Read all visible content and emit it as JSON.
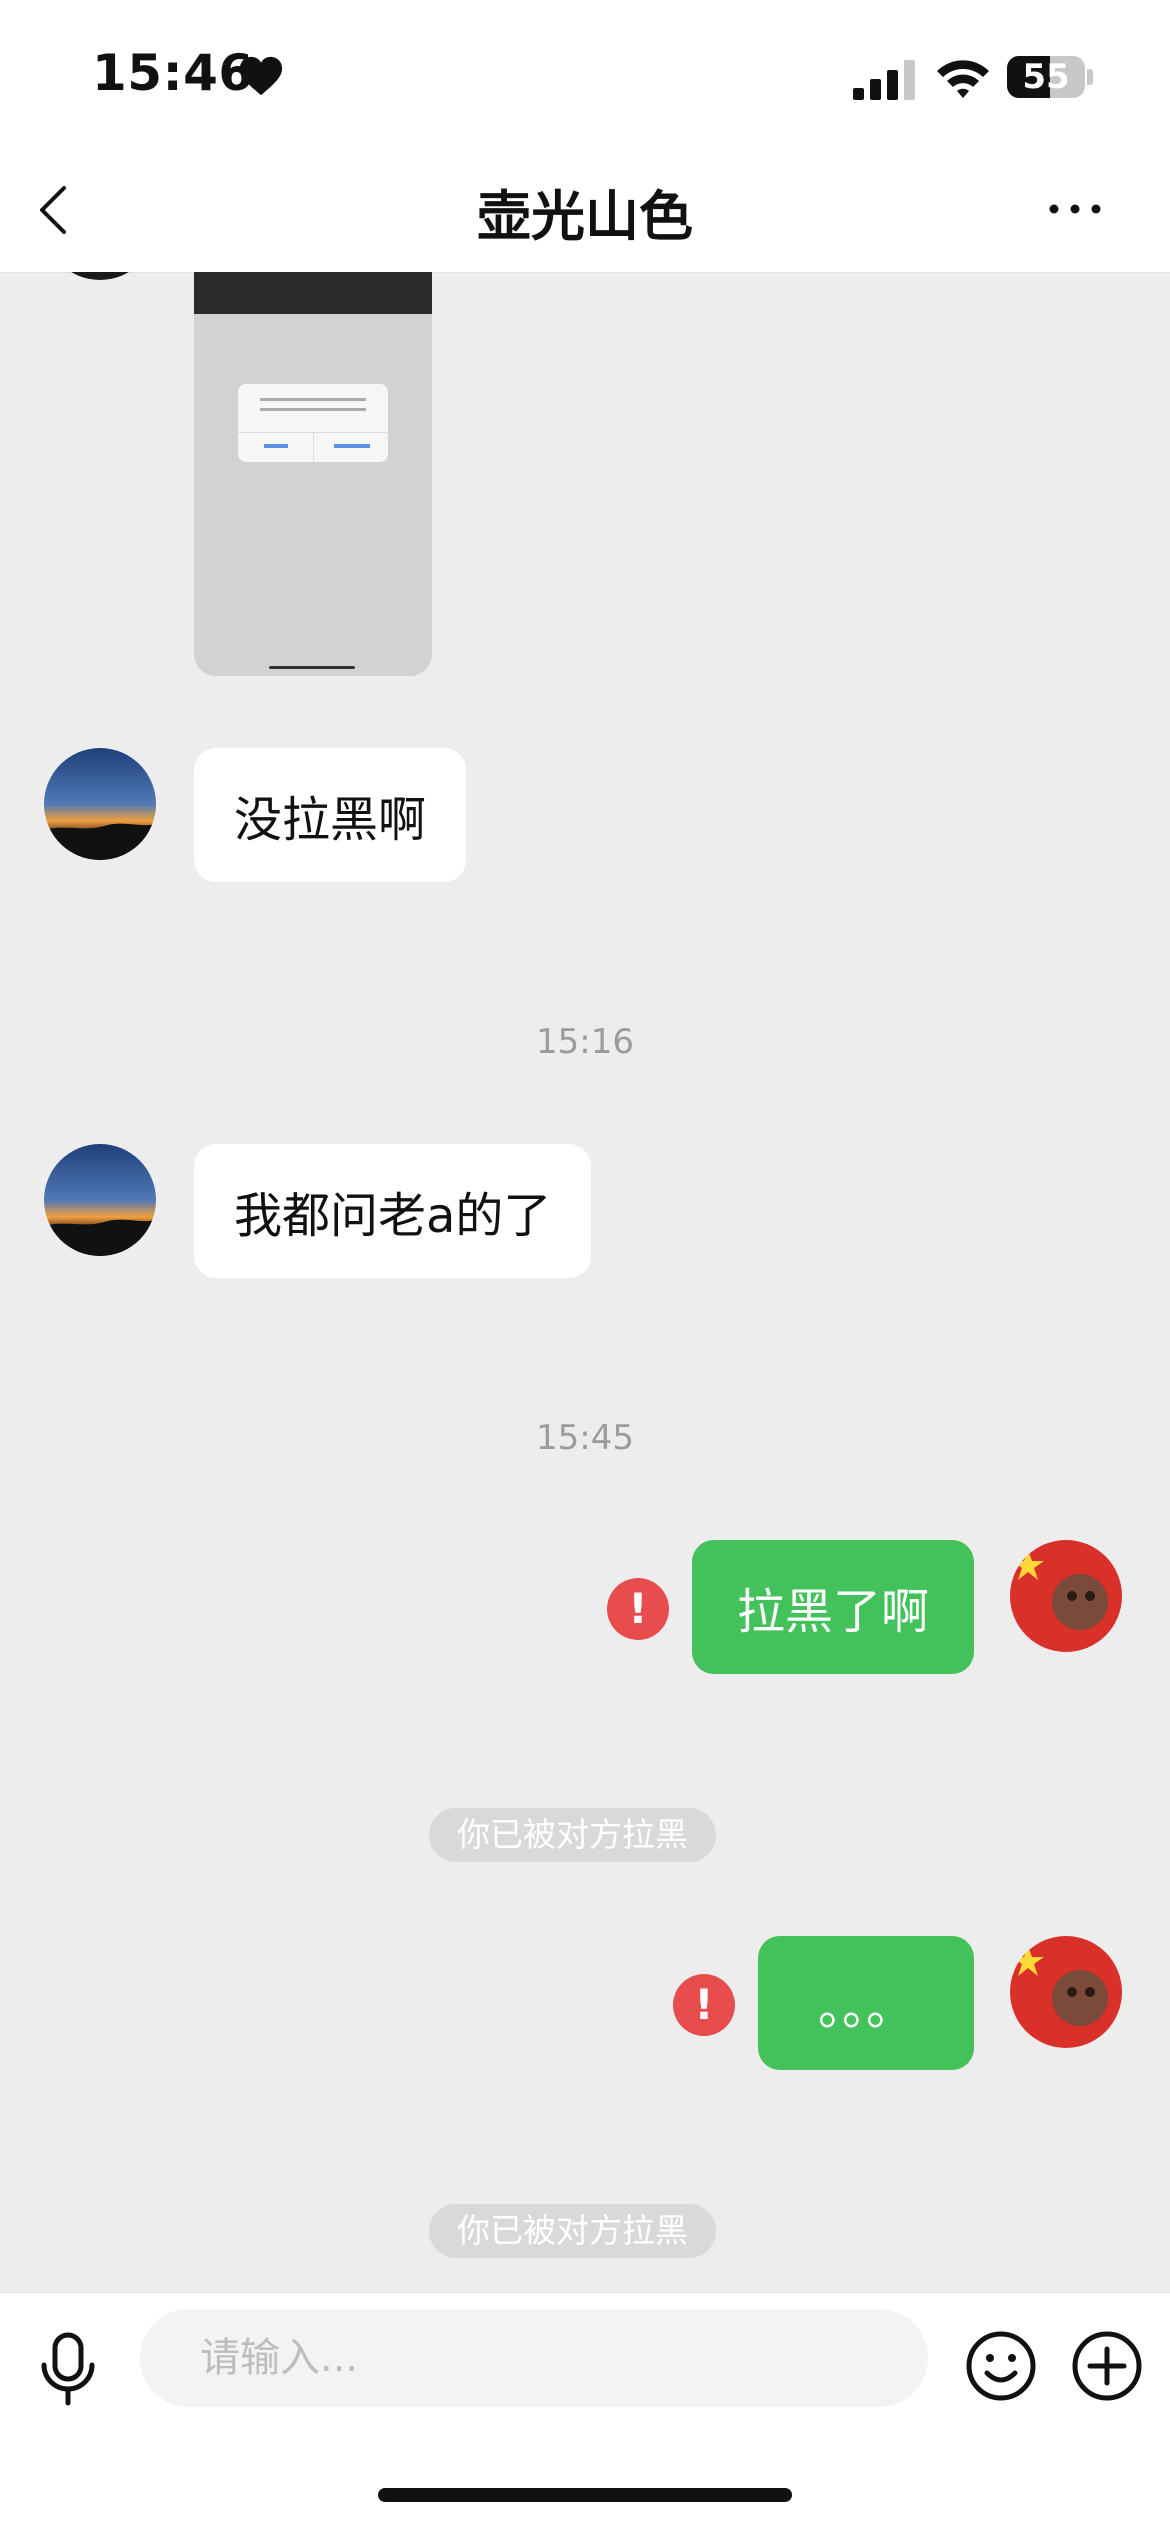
{
  "status_bar": {
    "time": "15:46",
    "battery": "55",
    "battery_level": 0.55
  },
  "nav": {
    "title": "壶光山色"
  },
  "messages": [
    {
      "side": "left",
      "type": "image"
    },
    {
      "side": "left",
      "type": "text",
      "text": "没拉黑啊"
    },
    {
      "type": "timestamp",
      "text": "15:16"
    },
    {
      "side": "left",
      "type": "text",
      "text": "我都问老a的了"
    },
    {
      "type": "timestamp",
      "text": "15:45"
    },
    {
      "side": "right",
      "type": "text",
      "text": "拉黑了啊",
      "failed": true
    },
    {
      "type": "system",
      "text": "你已被对方拉黑"
    },
    {
      "side": "right",
      "type": "text",
      "text": "。。。",
      "failed": true
    },
    {
      "type": "system",
      "text": "你已被对方拉黑"
    }
  ],
  "input": {
    "placeholder": "请输入..."
  },
  "colors": {
    "bubble_sent": "#43C15A",
    "error": "#E84D4D",
    "background": "#EDEDED"
  },
  "icons": [
    "heart-icon",
    "signal-icon",
    "wifi-icon",
    "battery-icon",
    "back-icon",
    "more-icon",
    "microphone-icon",
    "emoji-icon",
    "plus-icon",
    "error-icon"
  ]
}
